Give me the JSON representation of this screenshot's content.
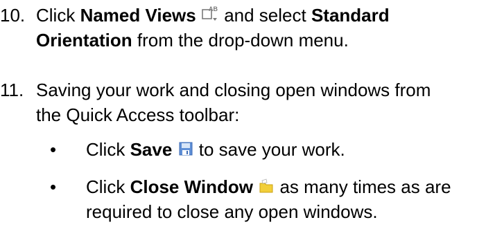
{
  "steps": [
    {
      "number": "10.",
      "pre": "Click ",
      "bold1": "Named Views",
      "icon": "named-views-icon",
      "mid": " and select ",
      "bold2": "Standard Orientation",
      "post": " from the drop-down menu."
    },
    {
      "number": "11.",
      "text": "Saving your work and closing open windows from the Quick Access toolbar:"
    }
  ],
  "bullets": [
    {
      "dot": "•",
      "pre": "Click ",
      "bold": "Save",
      "icon": "save-icon",
      "post": " to save your work."
    },
    {
      "dot": "•",
      "pre": "Click ",
      "bold": "Close Window",
      "icon": "close-window-icon",
      "post": " as many times as are required to close any open windows."
    }
  ],
  "icon_colors": {
    "named_views": "#7a7a7a",
    "save_body": "#5f8fd6",
    "save_label": "#d8e6f8",
    "folder": "#f2cf3a"
  }
}
